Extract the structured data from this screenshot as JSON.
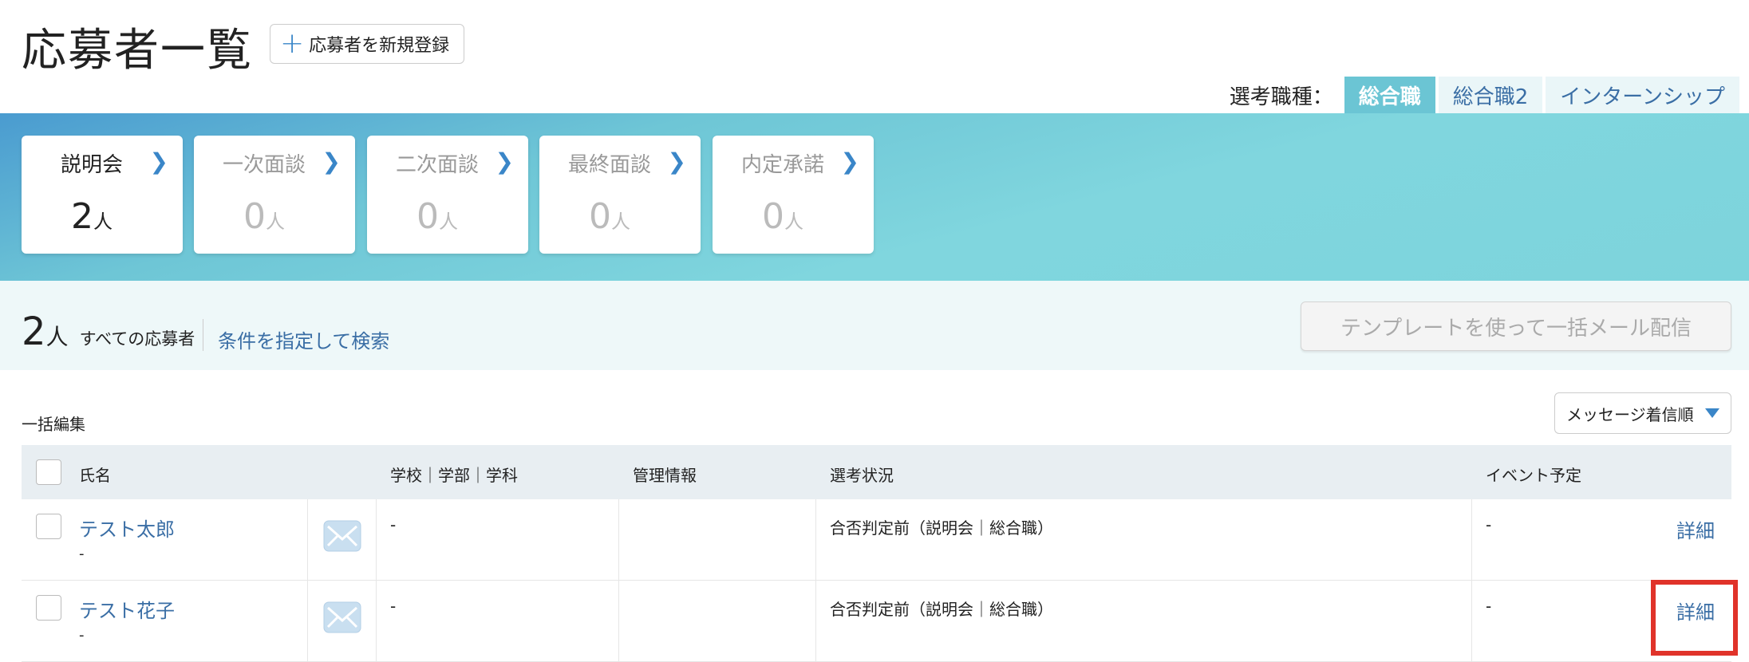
{
  "header": {
    "title": "応募者一覧",
    "add_button_icon": "plus-icon",
    "add_button_label": "応募者を新規登録"
  },
  "job_type": {
    "label": "選考職種：",
    "tabs": [
      {
        "label": "総合職",
        "active": true
      },
      {
        "label": "総合職2",
        "active": false
      },
      {
        "label": "インターンシップ",
        "active": false
      }
    ]
  },
  "stages": [
    {
      "name": "説明会",
      "count": "2",
      "unit": "人",
      "active": true
    },
    {
      "name": "一次面談",
      "count": "0",
      "unit": "人",
      "active": false
    },
    {
      "name": "二次面談",
      "count": "0",
      "unit": "人",
      "active": false
    },
    {
      "name": "最終面談",
      "count": "0",
      "unit": "人",
      "active": false
    },
    {
      "name": "内定承諾",
      "count": "0",
      "unit": "人",
      "active": false
    }
  ],
  "summary": {
    "total": "2",
    "unit": "人",
    "label": "すべての応募者",
    "search_link": "条件を指定して検索",
    "mail_all_button": "テンプレートを使って一括メール配信"
  },
  "list": {
    "bulk_edit_label": "一括編集",
    "sort_selected": "メッセージ着信順",
    "columns": {
      "name": "氏名",
      "school": "学校｜学部｜学科",
      "admin": "管理情報",
      "status": "選考状況",
      "event": "イベント予定"
    },
    "rows": [
      {
        "name": "テスト太郎",
        "sub": "-",
        "school": "-",
        "admin": "",
        "status": "合否判定前（説明会｜総合職）",
        "event": "-",
        "detail": "詳細"
      },
      {
        "name": "テスト花子",
        "sub": "-",
        "school": "-",
        "admin": "",
        "status": "合否判定前（説明会｜総合職）",
        "event": "-",
        "detail": "詳細"
      }
    ]
  },
  "colors": {
    "accent": "#3a86c8",
    "link": "#3a6ea5",
    "active_tab": "#6bc5d4",
    "highlight": "#e0332a"
  }
}
